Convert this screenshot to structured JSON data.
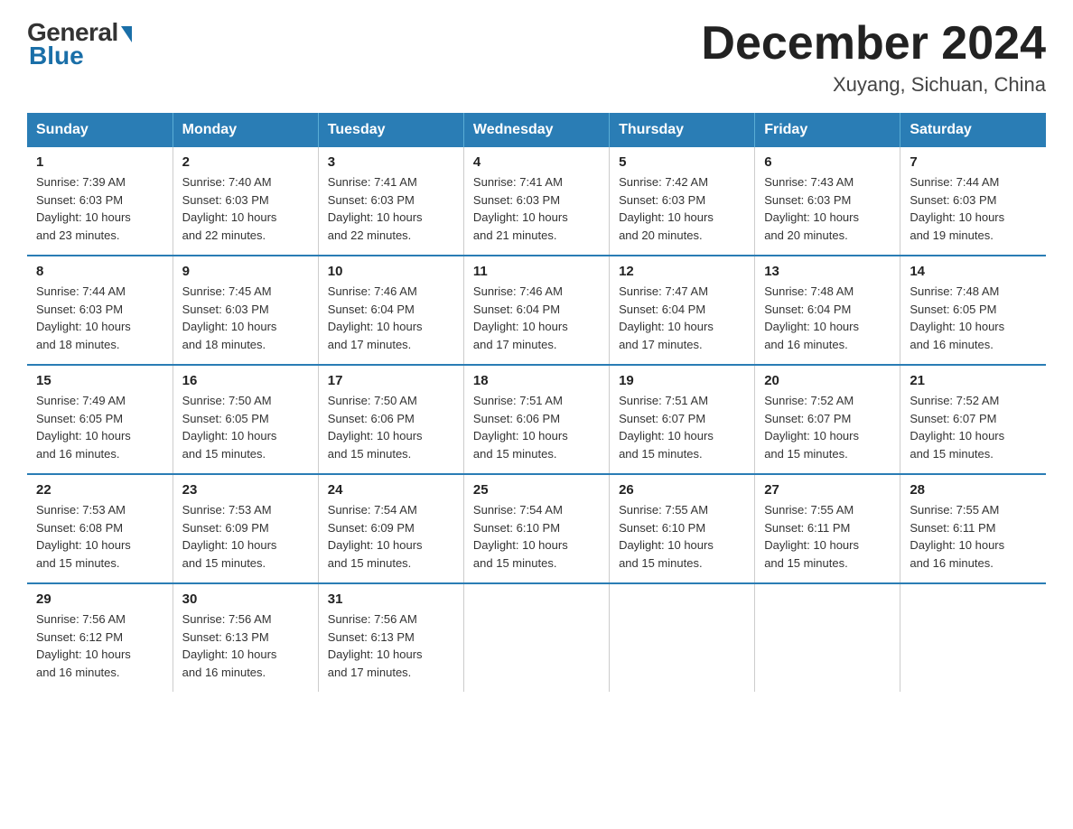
{
  "logo": {
    "general": "General",
    "blue": "Blue"
  },
  "header": {
    "title": "December 2024",
    "location": "Xuyang, Sichuan, China"
  },
  "days_of_week": [
    "Sunday",
    "Monday",
    "Tuesday",
    "Wednesday",
    "Thursday",
    "Friday",
    "Saturday"
  ],
  "weeks": [
    [
      {
        "day": "1",
        "sunrise": "7:39 AM",
        "sunset": "6:03 PM",
        "daylight": "10 hours and 23 minutes."
      },
      {
        "day": "2",
        "sunrise": "7:40 AM",
        "sunset": "6:03 PM",
        "daylight": "10 hours and 22 minutes."
      },
      {
        "day": "3",
        "sunrise": "7:41 AM",
        "sunset": "6:03 PM",
        "daylight": "10 hours and 22 minutes."
      },
      {
        "day": "4",
        "sunrise": "7:41 AM",
        "sunset": "6:03 PM",
        "daylight": "10 hours and 21 minutes."
      },
      {
        "day": "5",
        "sunrise": "7:42 AM",
        "sunset": "6:03 PM",
        "daylight": "10 hours and 20 minutes."
      },
      {
        "day": "6",
        "sunrise": "7:43 AM",
        "sunset": "6:03 PM",
        "daylight": "10 hours and 20 minutes."
      },
      {
        "day": "7",
        "sunrise": "7:44 AM",
        "sunset": "6:03 PM",
        "daylight": "10 hours and 19 minutes."
      }
    ],
    [
      {
        "day": "8",
        "sunrise": "7:44 AM",
        "sunset": "6:03 PM",
        "daylight": "10 hours and 18 minutes."
      },
      {
        "day": "9",
        "sunrise": "7:45 AM",
        "sunset": "6:03 PM",
        "daylight": "10 hours and 18 minutes."
      },
      {
        "day": "10",
        "sunrise": "7:46 AM",
        "sunset": "6:04 PM",
        "daylight": "10 hours and 17 minutes."
      },
      {
        "day": "11",
        "sunrise": "7:46 AM",
        "sunset": "6:04 PM",
        "daylight": "10 hours and 17 minutes."
      },
      {
        "day": "12",
        "sunrise": "7:47 AM",
        "sunset": "6:04 PM",
        "daylight": "10 hours and 17 minutes."
      },
      {
        "day": "13",
        "sunrise": "7:48 AM",
        "sunset": "6:04 PM",
        "daylight": "10 hours and 16 minutes."
      },
      {
        "day": "14",
        "sunrise": "7:48 AM",
        "sunset": "6:05 PM",
        "daylight": "10 hours and 16 minutes."
      }
    ],
    [
      {
        "day": "15",
        "sunrise": "7:49 AM",
        "sunset": "6:05 PM",
        "daylight": "10 hours and 16 minutes."
      },
      {
        "day": "16",
        "sunrise": "7:50 AM",
        "sunset": "6:05 PM",
        "daylight": "10 hours and 15 minutes."
      },
      {
        "day": "17",
        "sunrise": "7:50 AM",
        "sunset": "6:06 PM",
        "daylight": "10 hours and 15 minutes."
      },
      {
        "day": "18",
        "sunrise": "7:51 AM",
        "sunset": "6:06 PM",
        "daylight": "10 hours and 15 minutes."
      },
      {
        "day": "19",
        "sunrise": "7:51 AM",
        "sunset": "6:07 PM",
        "daylight": "10 hours and 15 minutes."
      },
      {
        "day": "20",
        "sunrise": "7:52 AM",
        "sunset": "6:07 PM",
        "daylight": "10 hours and 15 minutes."
      },
      {
        "day": "21",
        "sunrise": "7:52 AM",
        "sunset": "6:07 PM",
        "daylight": "10 hours and 15 minutes."
      }
    ],
    [
      {
        "day": "22",
        "sunrise": "7:53 AM",
        "sunset": "6:08 PM",
        "daylight": "10 hours and 15 minutes."
      },
      {
        "day": "23",
        "sunrise": "7:53 AM",
        "sunset": "6:09 PM",
        "daylight": "10 hours and 15 minutes."
      },
      {
        "day": "24",
        "sunrise": "7:54 AM",
        "sunset": "6:09 PM",
        "daylight": "10 hours and 15 minutes."
      },
      {
        "day": "25",
        "sunrise": "7:54 AM",
        "sunset": "6:10 PM",
        "daylight": "10 hours and 15 minutes."
      },
      {
        "day": "26",
        "sunrise": "7:55 AM",
        "sunset": "6:10 PM",
        "daylight": "10 hours and 15 minutes."
      },
      {
        "day": "27",
        "sunrise": "7:55 AM",
        "sunset": "6:11 PM",
        "daylight": "10 hours and 15 minutes."
      },
      {
        "day": "28",
        "sunrise": "7:55 AM",
        "sunset": "6:11 PM",
        "daylight": "10 hours and 16 minutes."
      }
    ],
    [
      {
        "day": "29",
        "sunrise": "7:56 AM",
        "sunset": "6:12 PM",
        "daylight": "10 hours and 16 minutes."
      },
      {
        "day": "30",
        "sunrise": "7:56 AM",
        "sunset": "6:13 PM",
        "daylight": "10 hours and 16 minutes."
      },
      {
        "day": "31",
        "sunrise": "7:56 AM",
        "sunset": "6:13 PM",
        "daylight": "10 hours and 17 minutes."
      },
      null,
      null,
      null,
      null
    ]
  ],
  "labels": {
    "sunrise": "Sunrise:",
    "sunset": "Sunset:",
    "daylight": "Daylight:"
  }
}
